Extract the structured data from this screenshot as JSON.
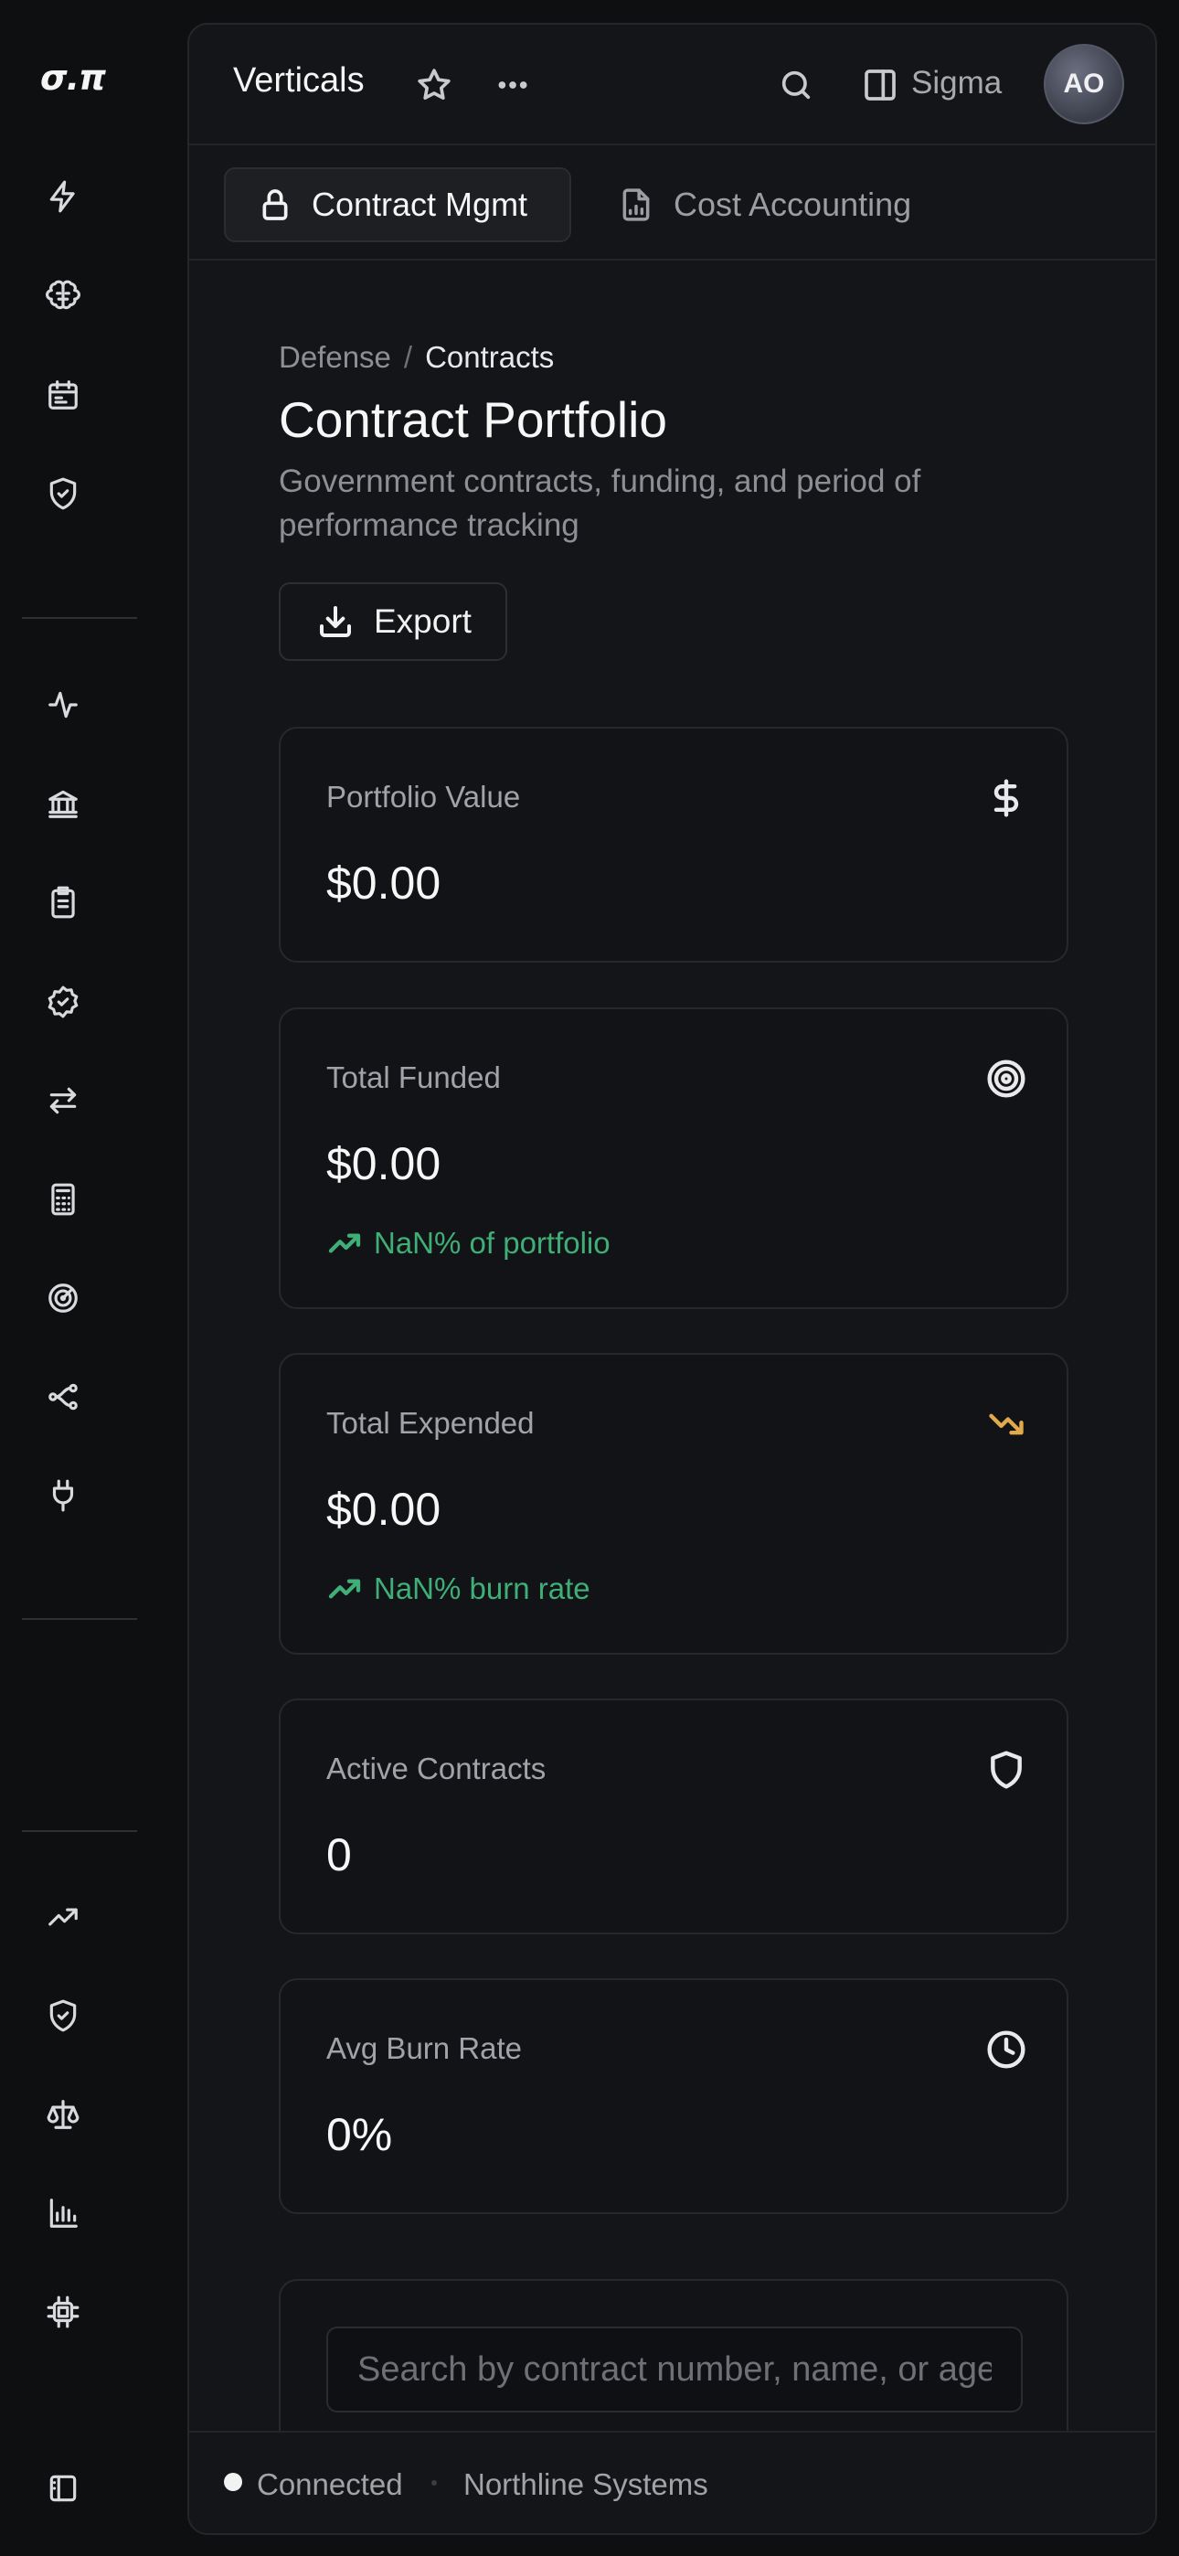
{
  "app": {
    "logo_text": "σ.π"
  },
  "topbar": {
    "title": "Verticals",
    "workspace": "Sigma",
    "avatar_initials": "AO"
  },
  "tabs": [
    {
      "label": "Contract Mgmt",
      "icon": "lock-icon",
      "active": true
    },
    {
      "label": "Cost Accounting",
      "icon": "file-chart-icon",
      "active": false
    }
  ],
  "breadcrumb": {
    "parent": "Defense",
    "separator": "/",
    "current": "Contracts"
  },
  "page": {
    "title": "Contract Portfolio",
    "subtitle": "Government contracts, funding, and period of performance tracking",
    "export_label": "Export"
  },
  "cards": {
    "portfolio_value": {
      "label": "Portfolio Value",
      "value": "$0.00",
      "icon": "dollar-icon"
    },
    "total_funded": {
      "label": "Total Funded",
      "value": "$0.00",
      "icon": "target-icon",
      "trend": "NaN% of portfolio"
    },
    "total_expended": {
      "label": "Total Expended",
      "value": "$0.00",
      "icon": "trending-down-icon",
      "trend": "NaN% burn rate"
    },
    "active_contracts": {
      "label": "Active Contracts",
      "value": "0",
      "icon": "shield-icon"
    },
    "avg_burn_rate": {
      "label": "Avg Burn Rate",
      "value": "0%",
      "icon": "clock-icon"
    }
  },
  "search": {
    "placeholder": "Search by contract number, name, or agency..."
  },
  "status": {
    "connection": "Connected",
    "organization": "Northline Systems"
  },
  "colors": {
    "background": "#0e0f11",
    "panel": "#141518",
    "positive": "#3fae77",
    "warning": "#e0a94a"
  }
}
